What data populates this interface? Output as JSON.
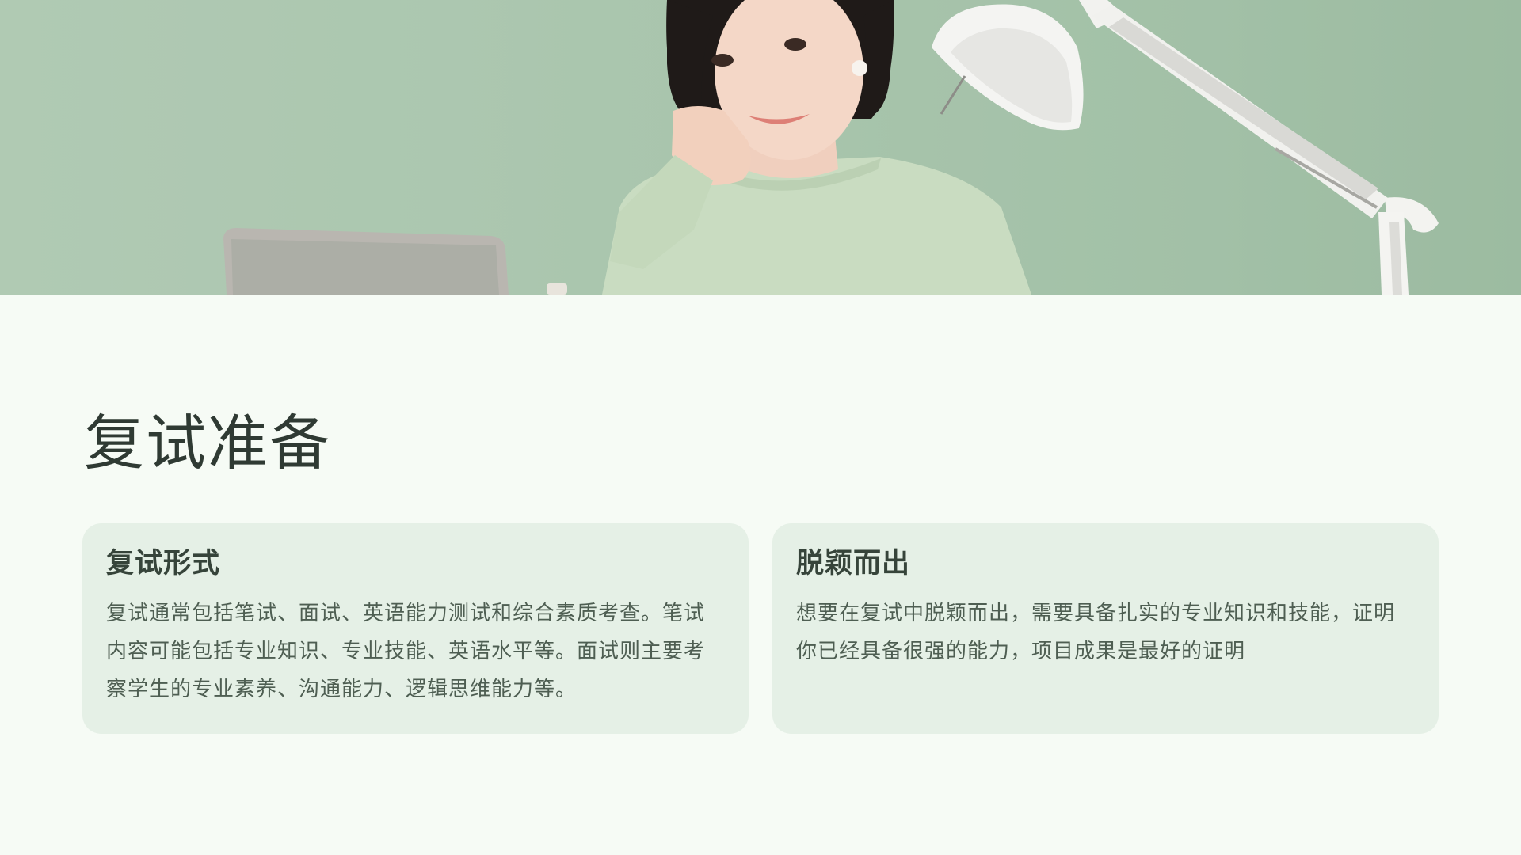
{
  "page": {
    "title": "复试准备"
  },
  "cards": [
    {
      "title": "复试形式",
      "body": "复试通常包括笔试、面试、英语能力测试和综合素质考查。笔试内容可能包括专业知识、专业技能、英语水平等。面试则主要考察学生的专业素养、沟通能力、逻辑思维能力等。"
    },
    {
      "title": "脱颖而出",
      "body": "想要在复试中脱颖而出，需要具备扎实的专业知识和技能，证明你已经具备很强的能力，项目成果是最好的证明"
    }
  ],
  "colors": {
    "background": "#f6fbf5",
    "hero_green": "#a9c5ad",
    "card_background": "#e5f0e6",
    "title_text": "#2f3a33",
    "body_text": "#4e5e52"
  }
}
